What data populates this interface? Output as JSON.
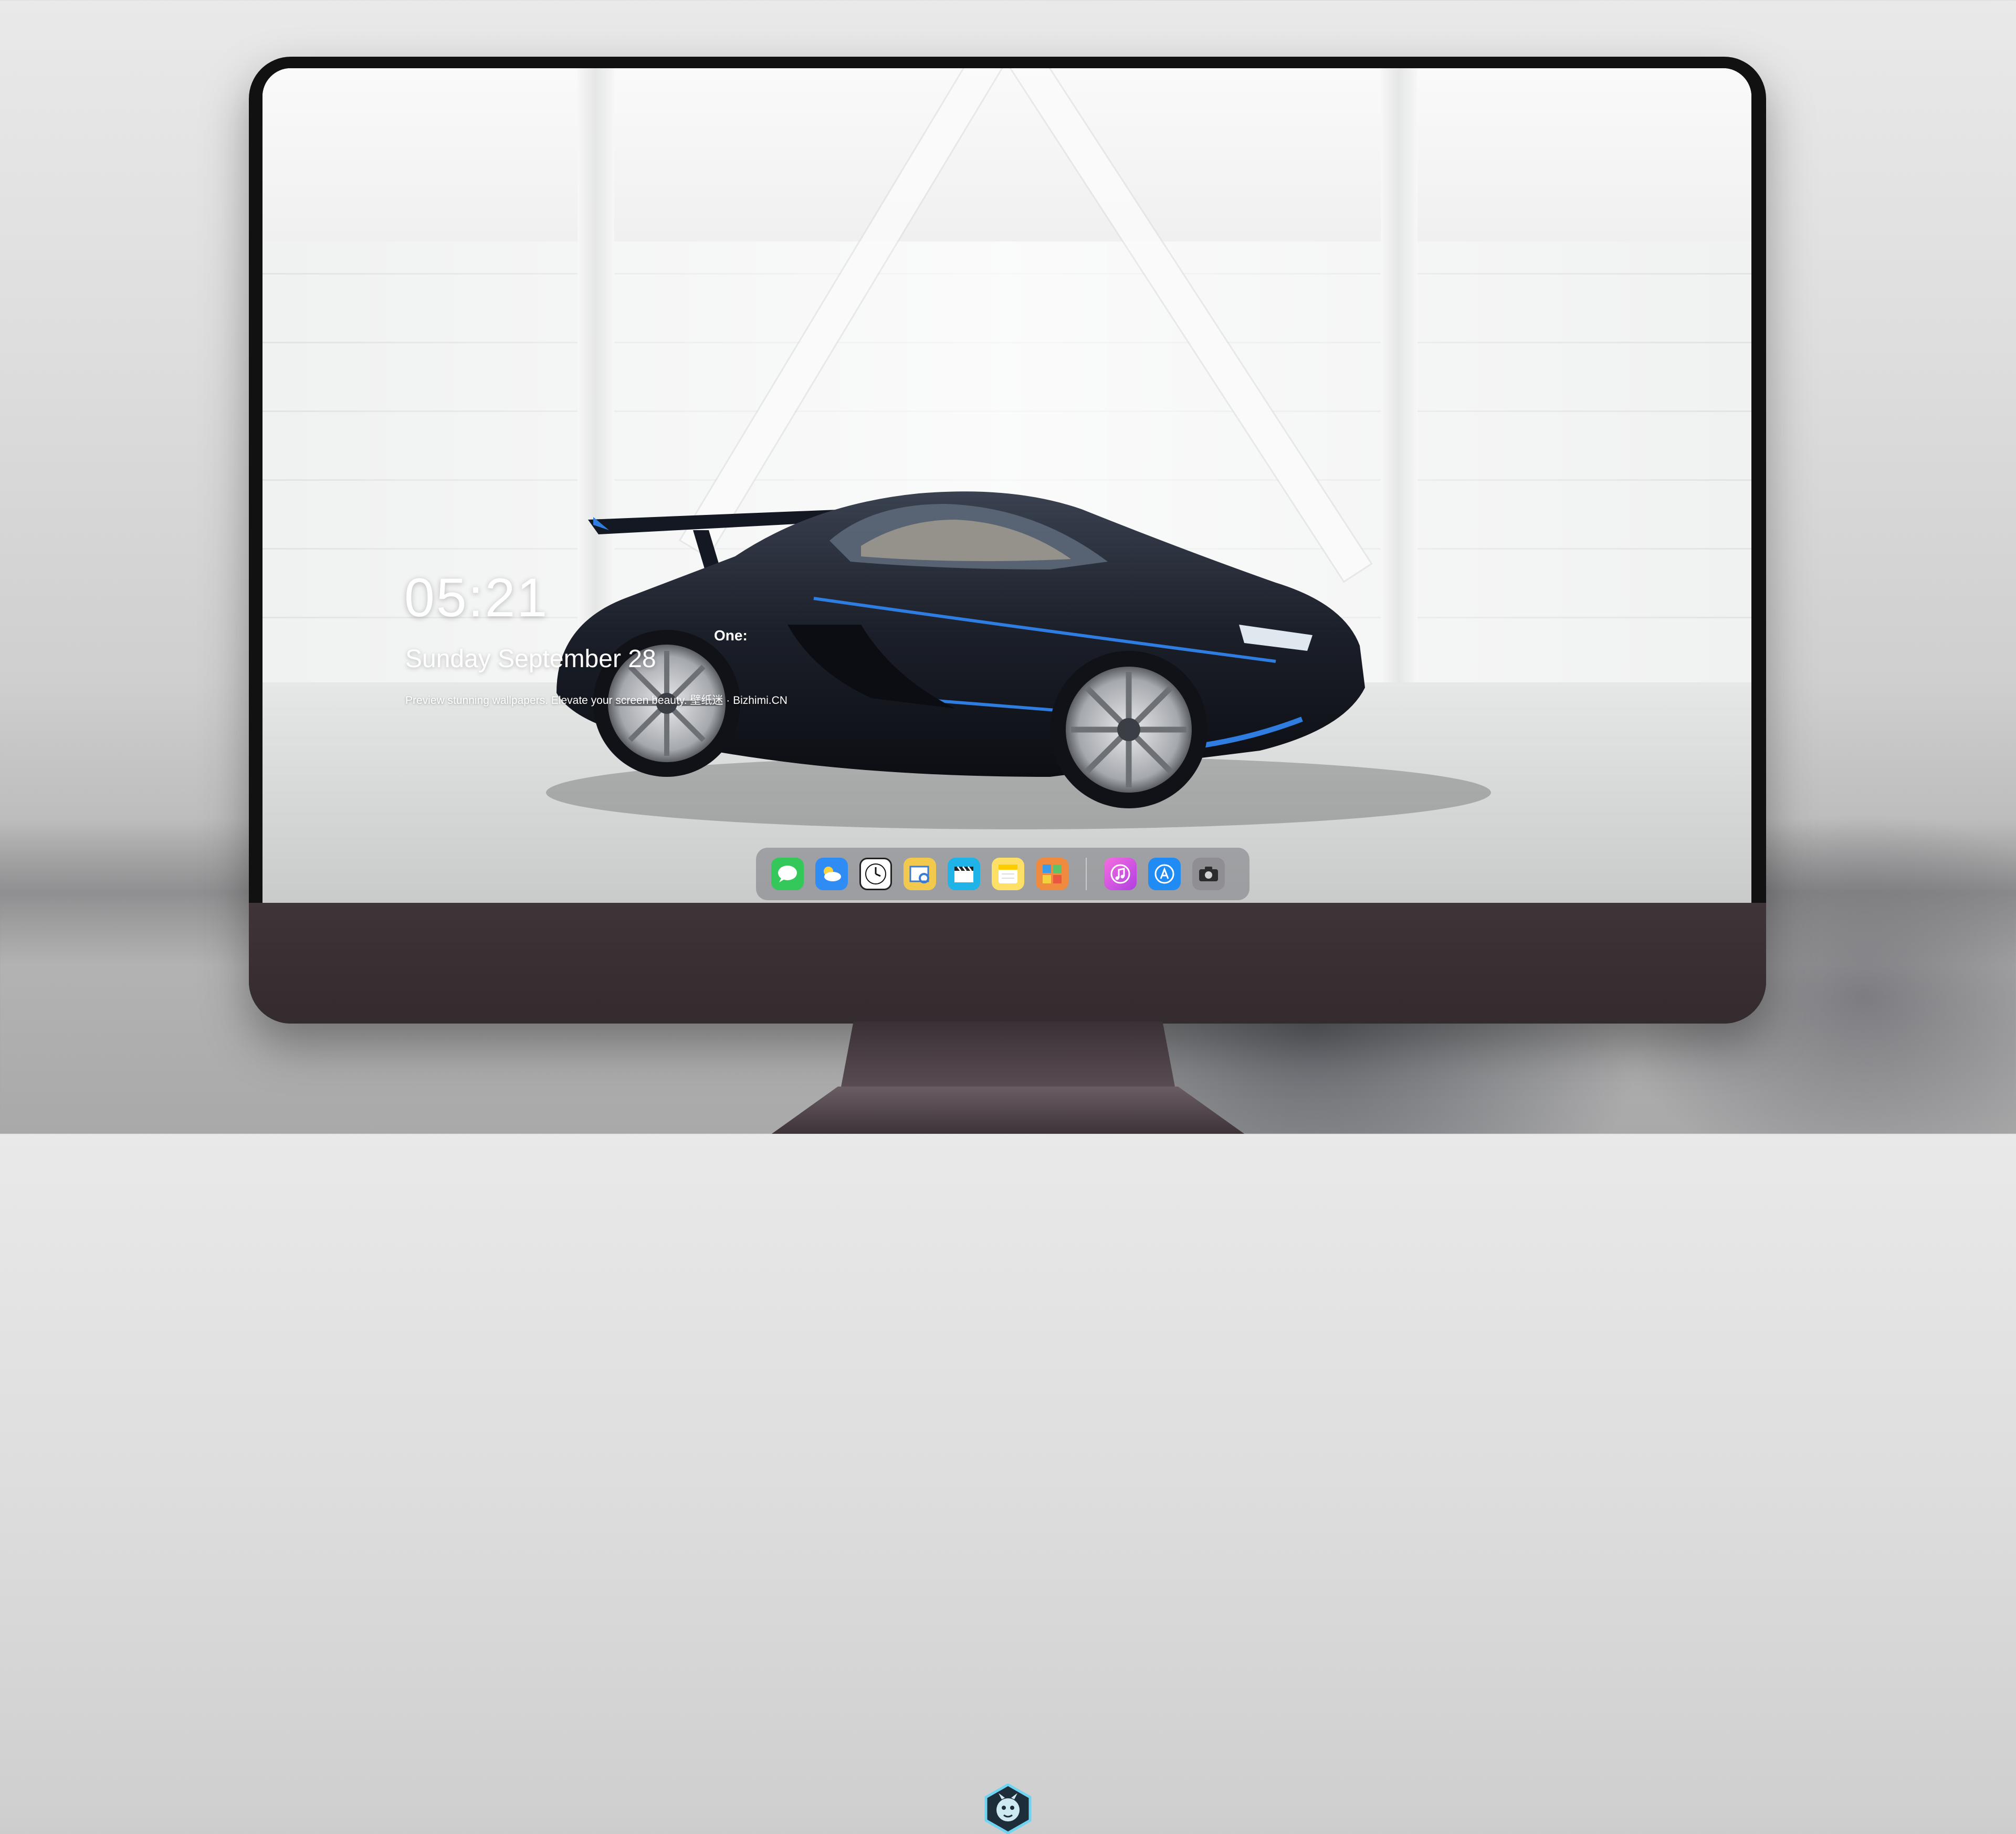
{
  "lockscreen": {
    "time": "05:21",
    "date": "Sunday September 28",
    "tagline": "Preview stunning wallpapers. Elevate your screen beauty. 壁纸迷 · Bizhimi.CN"
  },
  "car": {
    "badge": "One:"
  },
  "dock": {
    "apps": [
      {
        "icon": "messages-icon",
        "color": "#34c759"
      },
      {
        "icon": "weather-icon",
        "color": "#2f8cf5"
      },
      {
        "icon": "clock-icon",
        "color": "#ffffff"
      },
      {
        "icon": "preview-icon",
        "color": "#f2c94c"
      },
      {
        "icon": "video-editor-icon",
        "color": "#1fb3e8"
      },
      {
        "icon": "notes-icon",
        "color": "#ffe066"
      },
      {
        "icon": "photos-collage-icon",
        "color": "#f08a3e"
      },
      {
        "icon": "music-icon",
        "color": "#d94be0"
      },
      {
        "icon": "app-store-icon",
        "color": "#1f8bf3"
      },
      {
        "icon": "camera-icon",
        "color": "#8e8e93"
      }
    ]
  },
  "colors": {
    "chin": "#3f3438",
    "accent_blue": "#2f7de0"
  }
}
